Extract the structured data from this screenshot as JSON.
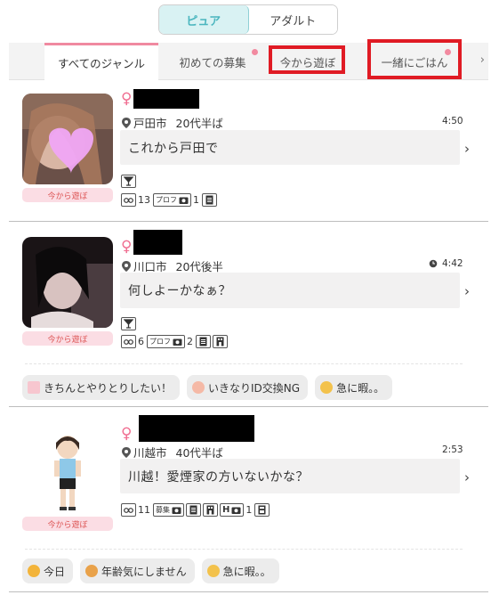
{
  "toggle": {
    "pure": "ピュア",
    "adult": "アダルト"
  },
  "tabs": [
    {
      "label": "すべてのジャンル"
    },
    {
      "label": "初めての募集"
    },
    {
      "label": "今から遊ぼ"
    },
    {
      "label": "一緒にごはん"
    }
  ],
  "tab_arrow": "›",
  "posts": [
    {
      "gender": "♀",
      "city": "戸田市",
      "age": "20代半ば",
      "time": "4:50",
      "message": "これから戸田で",
      "badge": "今から遊ぼ",
      "views": "13",
      "prof_label": "プロフ",
      "photos": "1"
    },
    {
      "gender": "♀",
      "city": "川口市",
      "age": "20代後半",
      "time": "4:42",
      "message": "何しよーかなぁ？",
      "badge": "今から遊ぼ",
      "views": "6",
      "prof_label": "プロフ",
      "photos": "2",
      "chips": [
        "きちんとやりとりしたい！",
        "いきなりID交換NG",
        "急に暇。。"
      ]
    },
    {
      "gender": "♀",
      "city": "川越市",
      "age": "40代半ば",
      "time": "2:53",
      "message": "川越！愛煙家の方いないかな？",
      "badge": "今から遊ぼ",
      "views": "11",
      "boshu_label": "募集",
      "h_label": "H",
      "h_count": "1",
      "chips": [
        "今日",
        "年齢気にしません",
        "急に暇。。"
      ]
    }
  ],
  "chevron": "›",
  "colors": {
    "accent_pink": "#f06e91",
    "teal": "#4bb6bf",
    "highlight_red": "#e01b24"
  }
}
